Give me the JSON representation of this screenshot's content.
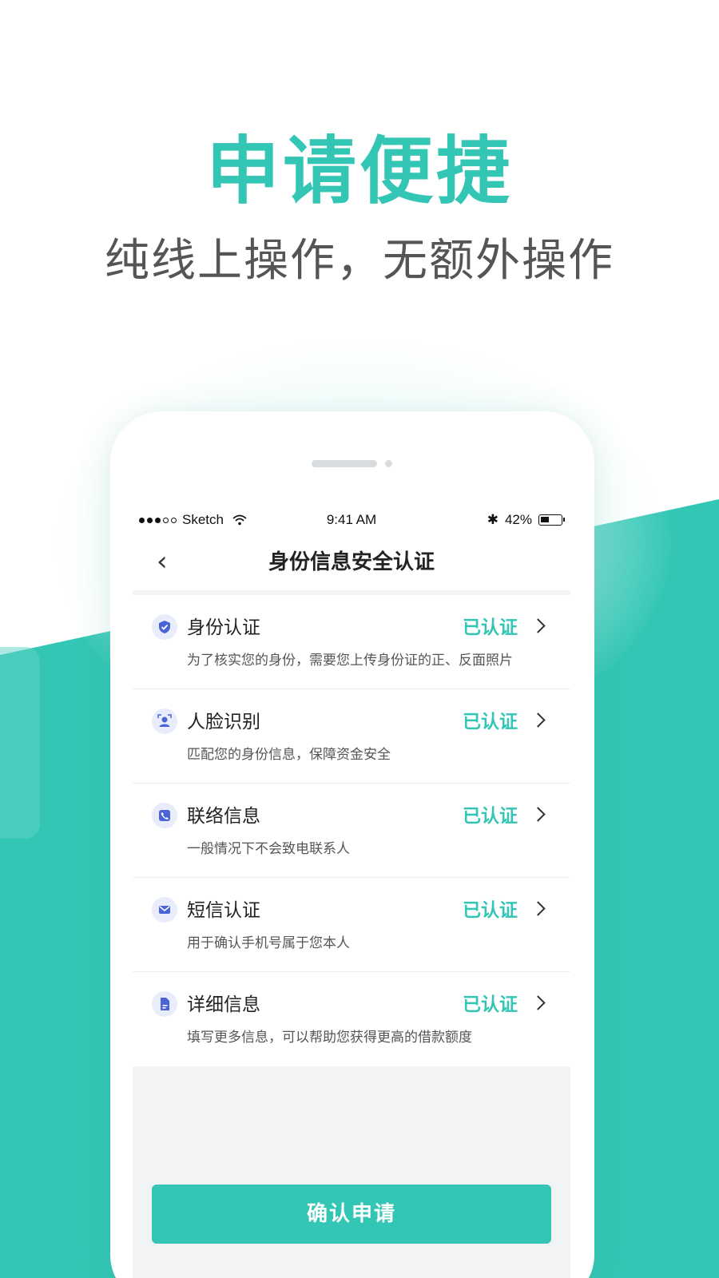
{
  "promo": {
    "headline": "申请便捷",
    "subline": "纯线上操作，无额外操作"
  },
  "colors": {
    "accent": "#33c6b4",
    "icon_blue": "#4a63d6",
    "icon_bg": "#e8ecfb"
  },
  "status_bar": {
    "carrier": "Sketch",
    "time": "9:41 AM",
    "bluetooth": "✱",
    "battery": "42%"
  },
  "navbar": {
    "back_icon": "‹",
    "title": "身份信息安全认证"
  },
  "items": [
    {
      "icon": "shield-icon",
      "title": "身份认证",
      "desc": "为了核实您的身份，需要您上传身份证的正、反面照片",
      "status": "已认证"
    },
    {
      "icon": "face-icon",
      "title": "人脸识别",
      "desc": "匹配您的身份信息，保障资金安全",
      "status": "已认证"
    },
    {
      "icon": "phone-icon",
      "title": "联络信息",
      "desc": "一般情况下不会致电联系人",
      "status": "已认证"
    },
    {
      "icon": "message-icon",
      "title": "短信认证",
      "desc": "用于确认手机号属于您本人",
      "status": "已认证"
    },
    {
      "icon": "document-icon",
      "title": "详细信息",
      "desc": "填写更多信息，可以帮助您获得更高的借款额度",
      "status": "已认证"
    }
  ],
  "confirm_button": "确认申请"
}
